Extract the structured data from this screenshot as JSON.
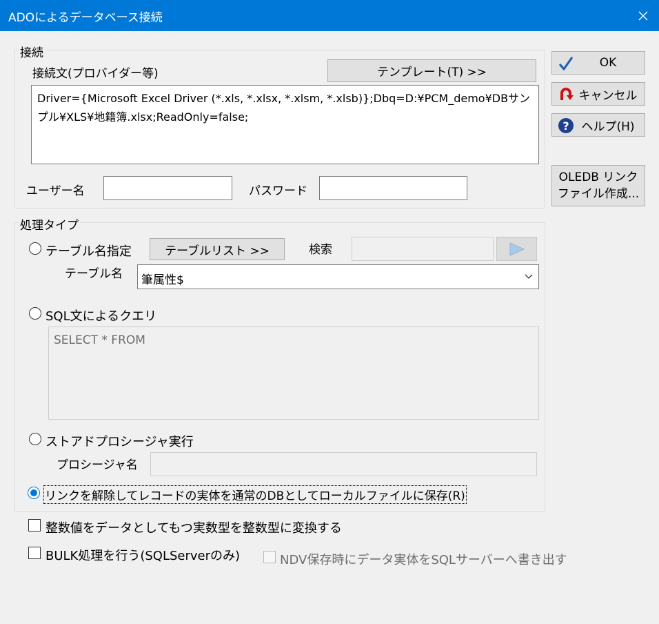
{
  "window": {
    "title": "ADOによるデータベース接続"
  },
  "connection": {
    "group_label": "接続",
    "string_label": "接続文(プロバイダー等)",
    "template_button": "テンプレート(T) >>",
    "connection_string": "Driver={Microsoft Excel Driver (*.xls, *.xlsx, *.xlsm, *.xlsb)};Dbq=D:¥PCM_demo¥DBサンプル¥XLS¥地籍簿.xlsx;ReadOnly=false;",
    "username_label": "ユーザー名",
    "username_value": "",
    "password_label": "パスワード",
    "password_value": ""
  },
  "side_buttons": {
    "ok": "OK",
    "cancel": "キャンセル",
    "help": "ヘルプ(H)",
    "oledb_line1": "OLEDB リンク",
    "oledb_line2": "ファイル作成..."
  },
  "processing": {
    "group_label": "処理タイプ",
    "table_option": "テーブル名指定",
    "table_list_button": "テーブルリスト >>",
    "search_label": "検索",
    "search_value": "",
    "table_name_label": "テーブル名",
    "table_name_value": "筆属性$",
    "sql_option": "SQL文によるクエリ",
    "sql_text": "SELECT * FROM",
    "stored_proc_option": "ストアドプロシージャ実行",
    "proc_name_label": "プロシージャ名",
    "proc_name_value": "",
    "unlink_option": "リンクを解除してレコードの実体を通常のDBとしてローカルファイルに保存(R)",
    "selected": "unlink"
  },
  "options": {
    "convert_real": "整数値をデータとしてもつ実数型を整数型に変換する",
    "bulk": "BULK処理を行う(SQLServerのみ)",
    "ndv": "NDV保存時にデータ実体をSQLサーバーへ書き出す"
  }
}
